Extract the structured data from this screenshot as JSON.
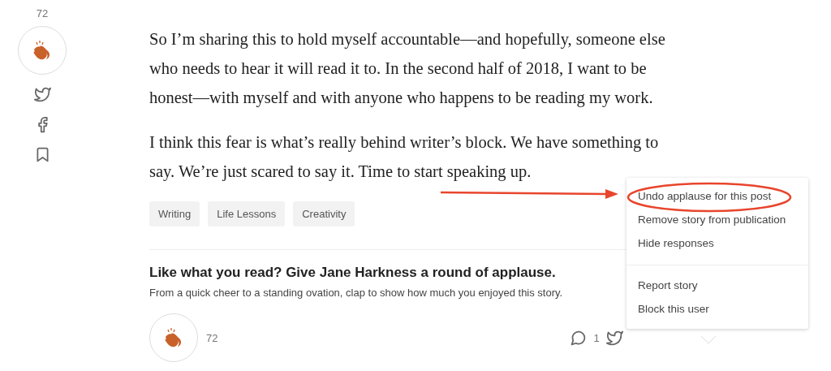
{
  "sidebar": {
    "clap_count": "72"
  },
  "article": {
    "paragraphs": [
      "So I’m sharing this to hold myself accountable—and hopefully, someone else who needs to hear it will read it to. In the second half of 2018, I want to be honest—with myself and with anyone who happens to be reading my work.",
      "I think this fear is what’s really behind writer’s block. We have something to say. We’re just scared to say it. Time to start speaking up."
    ],
    "tags": [
      "Writing",
      "Life Lessons",
      "Creativity"
    ]
  },
  "applause": {
    "heading": "Like what you read? Give Jane Harkness a round of applause.",
    "subtext": "From a quick cheer to a standing ovation, clap to show how much you enjoyed this story.",
    "clap_count": "72",
    "response_count": "1"
  },
  "menu": {
    "groups": [
      [
        "Undo applause for this post",
        "Remove story from publication",
        "Hide responses"
      ],
      [
        "Report story",
        "Block this user"
      ]
    ]
  }
}
